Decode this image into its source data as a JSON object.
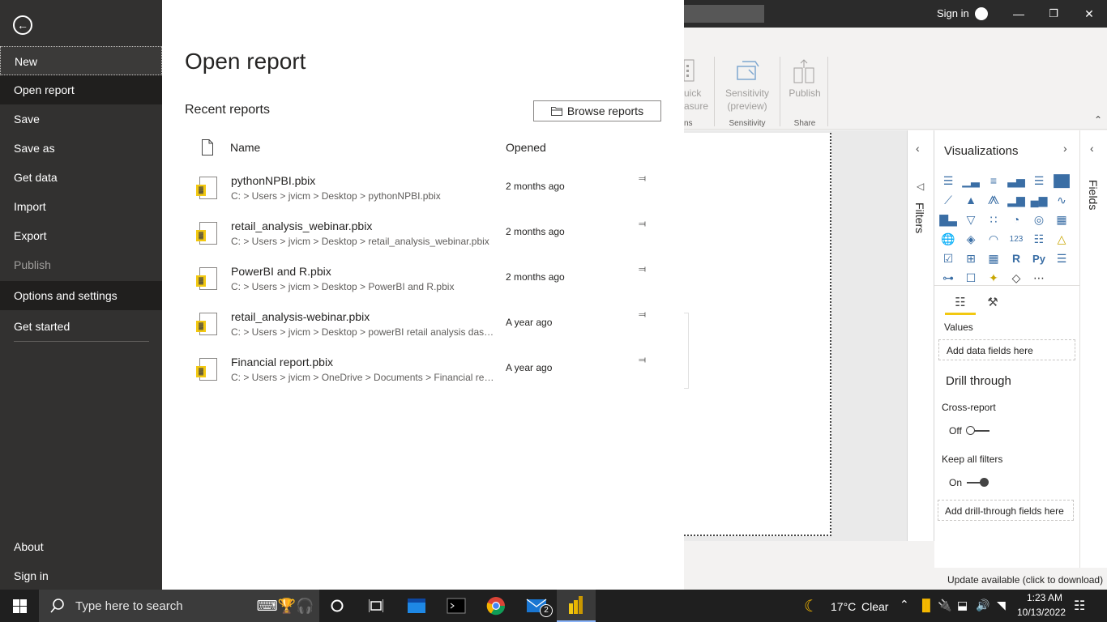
{
  "window": {
    "sign_in": "Sign in",
    "minimize": "—",
    "restore": "❐",
    "close": "✕"
  },
  "ribbon": {
    "quick_measure": "uick\nasure",
    "calc_group": "ns",
    "sensitivity": "Sensitivity\n(preview)",
    "sensitivity_group": "Sensitivity",
    "publish": "Publish",
    "share_group": "Share"
  },
  "panes": {
    "filters": "Filters",
    "visualizations": "Visualizations",
    "fields": "Fields",
    "values": "Values",
    "add_data_fields": "Add data fields here",
    "drill_through": "Drill through",
    "cross_report": "Cross-report",
    "cross_report_state": "Off",
    "keep_all_filters": "Keep all filters",
    "keep_all_filters_state": "On",
    "add_drill_fields": "Add drill-through fields here"
  },
  "status": {
    "update": "Update available (click to download)"
  },
  "backstage": {
    "menu": [
      {
        "label": "New"
      },
      {
        "label": "Open report"
      },
      {
        "label": "Save"
      },
      {
        "label": "Save as"
      },
      {
        "label": "Get data"
      },
      {
        "label": "Import"
      },
      {
        "label": "Export"
      },
      {
        "label": "Publish"
      },
      {
        "label": "Options and settings"
      },
      {
        "label": "Get started"
      },
      {
        "label": "About"
      },
      {
        "label": "Sign in"
      }
    ],
    "page_title": "Open report",
    "recent_label": "Recent reports",
    "browse_button": "Browse reports",
    "col_name": "Name",
    "col_opened": "Opened",
    "files": [
      {
        "name": "pythonNPBI.pbix",
        "path": "C: > Users > jvicm > Desktop > pythonNPBI.pbix",
        "opened": "2 months ago"
      },
      {
        "name": "retail_analysis_webinar.pbix",
        "path": "C: > Users > jvicm > Desktop > retail_analysis_webinar.pbix",
        "opened": "2 months ago"
      },
      {
        "name": "PowerBI and R.pbix",
        "path": "C: > Users > jvicm > Desktop > PowerBI and R.pbix",
        "opened": "2 months ago"
      },
      {
        "name": "retail_analysis-webinar.pbix",
        "path": "C: > Users > jvicm > Desktop > powerBI retail analysis dash...",
        "opened": "A year ago"
      },
      {
        "name": "Financial report.pbix",
        "path": "C: > Users > jvicm > OneDrive > Documents > Financial rep...",
        "opened": "A year ago"
      }
    ]
  },
  "taskbar": {
    "search_placeholder": "Type here to search",
    "mail_badge": "2",
    "weather_temp": "17°C",
    "weather_desc": "Clear",
    "time": "1:23 AM",
    "date": "10/13/2022"
  }
}
